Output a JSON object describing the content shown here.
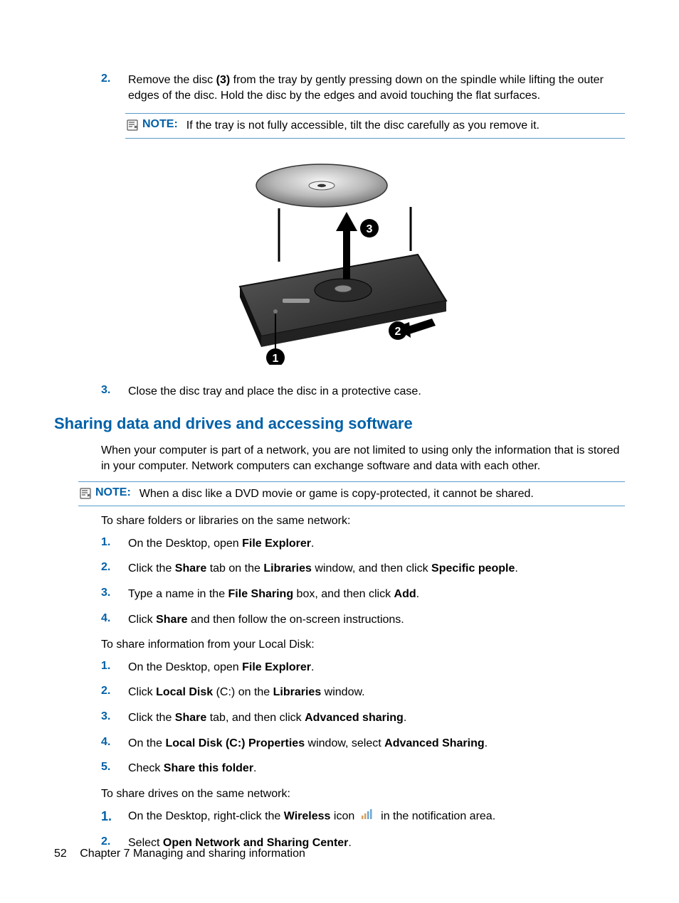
{
  "step2": {
    "num": "2.",
    "pre": "Remove the disc ",
    "bold": "(3)",
    "post": " from the tray by gently pressing down on the spindle while lifting the outer edges of the disc. Hold the disc by the edges and avoid touching the flat surfaces."
  },
  "note1": {
    "label": "NOTE:",
    "text": "If the tray is not fully accessible, tilt the disc carefully as you remove it."
  },
  "step3": {
    "num": "3.",
    "text": "Close the disc tray and place the disc in a protective case."
  },
  "heading": "Sharing data and drives and accessing software",
  "intro": "When your computer is part of a network, you are not limited to using only the information that is stored in your computer. Network computers can exchange software and data with each other.",
  "note2": {
    "label": "NOTE:",
    "text": "When a disc like a DVD movie or game is copy-protected, it cannot be shared."
  },
  "para_share_folders": "To share folders or libraries on the same network:",
  "listA": {
    "i1": {
      "num": "1.",
      "pre": "On the Desktop, open ",
      "b1": "File Explorer",
      "post": "."
    },
    "i2": {
      "num": "2.",
      "pre": "Click the ",
      "b1": "Share",
      "mid1": " tab on the ",
      "b2": "Libraries",
      "mid2": " window, and then click ",
      "b3": "Specific people",
      "post": "."
    },
    "i3": {
      "num": "3.",
      "pre": "Type a name in the ",
      "b1": "File Sharing",
      "mid1": " box, and then click ",
      "b2": "Add",
      "post": "."
    },
    "i4": {
      "num": "4.",
      "pre": "Click ",
      "b1": "Share",
      "post": " and then follow the on-screen instructions."
    }
  },
  "para_share_local": "To share information from your Local Disk:",
  "listB": {
    "i1": {
      "num": "1.",
      "pre": "On the Desktop, open ",
      "b1": "File Explorer",
      "post": "."
    },
    "i2": {
      "num": "2.",
      "pre": "Click ",
      "b1": "Local Disk ",
      "mid1": "(C:) on the ",
      "b2": "Libraries",
      "post": " window."
    },
    "i3": {
      "num": "3.",
      "pre": "Click the ",
      "b1": "Share",
      "mid1": " tab, and then click ",
      "b2": "Advanced sharing",
      "post": "."
    },
    "i4": {
      "num": "4.",
      "pre": "On the ",
      "b1": "Local Disk (C:) Properties",
      "mid1": " window, select ",
      "b2": "Advanced Sharing",
      "post": "."
    },
    "i5": {
      "num": "5.",
      "pre": "Check ",
      "b1": "Share this folder",
      "post": "."
    }
  },
  "para_share_drives": "To share drives on the same network:",
  "listC": {
    "i1": {
      "num": "1.",
      "pre": "On the Desktop, right-click the ",
      "b1": "Wireless",
      "mid1": " icon ",
      "post": " in the notification area."
    },
    "i2": {
      "num": "2.",
      "pre": "Select ",
      "b1": "Open Network and Sharing Center",
      "post": "."
    }
  },
  "footer": {
    "pagenum": "52",
    "chapter": "Chapter 7   Managing and sharing information"
  }
}
